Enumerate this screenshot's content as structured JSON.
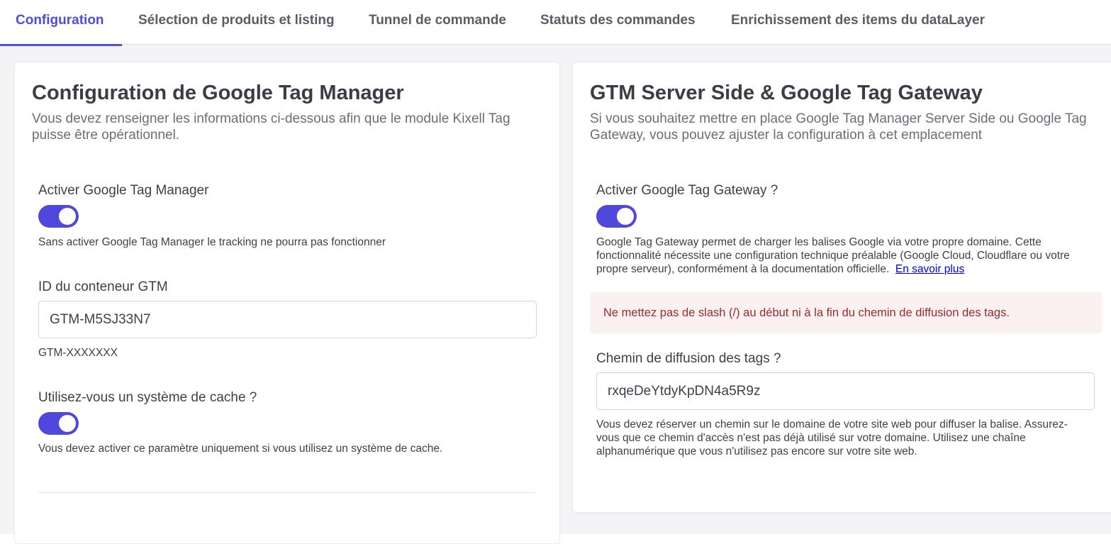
{
  "tabs": [
    {
      "label": "Configuration",
      "active": true
    },
    {
      "label": "Sélection de produits et listing",
      "active": false
    },
    {
      "label": "Tunnel de commande",
      "active": false
    },
    {
      "label": "Statuts des commandes",
      "active": false
    },
    {
      "label": "Enrichissement des items du dataLayer",
      "active": false
    }
  ],
  "colors": {
    "accent": "#5048dc",
    "alert_background": "#fbf1f1",
    "alert_text": "#9a2b2b",
    "link": "#0000ee"
  },
  "gtm_card": {
    "title": "Configuration de Google Tag Manager",
    "subtitle": "Vous devez renseigner les informations ci-dessous afin que le module Kixell Tag puisse être opérationnel.",
    "enable_gtm": {
      "label": "Activer Google Tag Manager",
      "enabled": true,
      "help": "Sans activer Google Tag Manager le tracking ne pourra pas fonctionner"
    },
    "container_id": {
      "label": "ID du conteneur GTM",
      "value": "GTM-M5SJ33N7",
      "help": "GTM-XXXXXXX"
    },
    "cache": {
      "label": "Utilisez-vous un système de cache ?",
      "enabled": true,
      "help": "Vous devez activer ce paramètre uniquement si vous utilisez un système de cache."
    }
  },
  "gateway_card": {
    "title": "GTM Server Side & Google Tag Gateway",
    "subtitle": "Si vous souhaitez mettre en place Google Tag Manager Server Side ou Google Tag Gateway, vous pouvez ajuster la configuration à cet emplacement",
    "enable_gateway": {
      "label": "Activer Google Tag Gateway ?",
      "enabled": true,
      "help": "Google Tag Gateway permet de charger les balises Google via votre propre domaine. Cette fonctionnalité nécessite une configuration technique préalable (Google Cloud, Cloudflare ou votre propre serveur), conformément à la documentation officielle.",
      "link_label": "En savoir plus"
    },
    "alert": "Ne mettez pas de slash (/) au début ni à la fin du chemin de diffusion des tags.",
    "tag_path": {
      "label": "Chemin de diffusion des tags ?",
      "value": "rxqeDeYtdyKpDN4a5R9z",
      "help": "Vous devez réserver un chemin sur le domaine de votre site web pour diffuser la balise. Assurez-vous que ce chemin d'accès n'est pas déjà utilisé sur votre domaine. Utilisez une chaîne alphanumérique que vous n'utilisez pas encore sur votre site web."
    }
  }
}
